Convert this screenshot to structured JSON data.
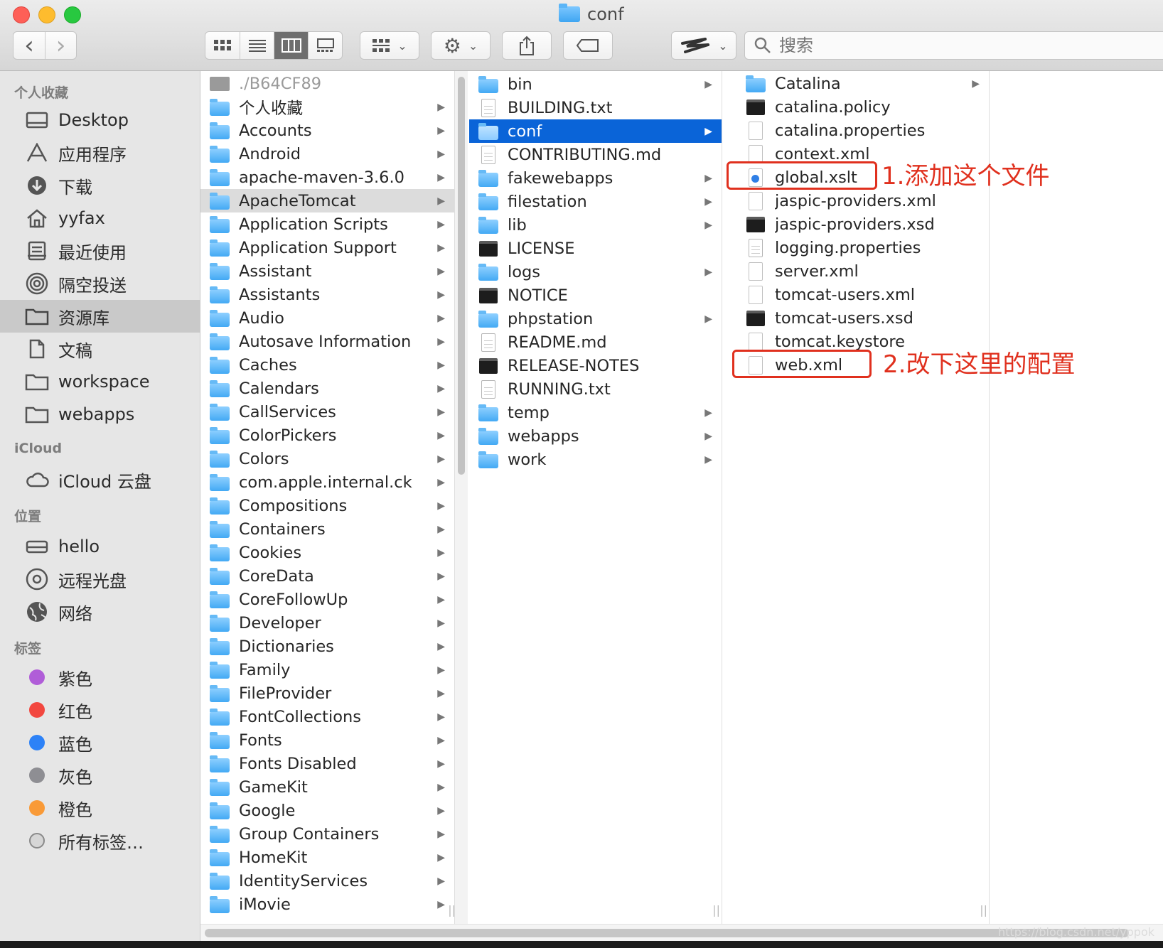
{
  "window": {
    "title": "conf"
  },
  "toolbar": {
    "back_glyph": "‹",
    "forward_glyph": "›",
    "search_placeholder": "搜索"
  },
  "sidebar": {
    "favorites_header": "个人收藏",
    "favorites": [
      {
        "label": "Desktop",
        "icon": "desktop-icon"
      },
      {
        "label": "应用程序",
        "icon": "applications-icon"
      },
      {
        "label": "下载",
        "icon": "download-icon"
      },
      {
        "label": "yyfax",
        "icon": "home-icon"
      },
      {
        "label": "最近使用",
        "icon": "recents-icon"
      },
      {
        "label": "隔空投送",
        "icon": "airdrop-icon"
      },
      {
        "label": "资源库",
        "icon": "folder-icon",
        "selected": true
      },
      {
        "label": "文稿",
        "icon": "documents-icon"
      },
      {
        "label": "workspace",
        "icon": "folder-icon"
      },
      {
        "label": "webapps",
        "icon": "folder-icon"
      }
    ],
    "icloud_header": "iCloud",
    "icloud": [
      {
        "label": "iCloud 云盘",
        "icon": "cloud-icon"
      }
    ],
    "locations_header": "位置",
    "locations": [
      {
        "label": "hello",
        "icon": "drive-icon"
      },
      {
        "label": "远程光盘",
        "icon": "disc-icon"
      },
      {
        "label": "网络",
        "icon": "network-icon"
      }
    ],
    "tags_header": "标签",
    "tags": [
      {
        "label": "紫色",
        "color": "#b05dd8"
      },
      {
        "label": "红色",
        "color": "#f2473f"
      },
      {
        "label": "蓝色",
        "color": "#2d82f7"
      },
      {
        "label": "灰色",
        "color": "#8e8e93"
      },
      {
        "label": "橙色",
        "color": "#f99a37"
      },
      {
        "label": "所有标签…",
        "color": ""
      }
    ]
  },
  "columns": [
    {
      "items": [
        {
          "label": "./B64CF89",
          "type": "drive",
          "dim": true
        },
        {
          "label": "个人收藏",
          "type": "folder",
          "chevron": true
        },
        {
          "label": "Accounts",
          "type": "folder",
          "chevron": true
        },
        {
          "label": "Android",
          "type": "folder",
          "chevron": true
        },
        {
          "label": "apache-maven-3.6.0",
          "type": "folder",
          "chevron": true
        },
        {
          "label": "ApacheTomcat",
          "type": "folder",
          "chevron": true,
          "selected": "gray"
        },
        {
          "label": "Application Scripts",
          "type": "folder",
          "chevron": true
        },
        {
          "label": "Application Support",
          "type": "folder",
          "chevron": true
        },
        {
          "label": "Assistant",
          "type": "folder",
          "chevron": true
        },
        {
          "label": "Assistants",
          "type": "folder",
          "chevron": true
        },
        {
          "label": "Audio",
          "type": "folder",
          "chevron": true
        },
        {
          "label": "Autosave Information",
          "type": "folder",
          "chevron": true
        },
        {
          "label": "Caches",
          "type": "folder",
          "chevron": true
        },
        {
          "label": "Calendars",
          "type": "folder",
          "chevron": true
        },
        {
          "label": "CallServices",
          "type": "folder",
          "chevron": true
        },
        {
          "label": "ColorPickers",
          "type": "folder",
          "chevron": true
        },
        {
          "label": "Colors",
          "type": "folder",
          "chevron": true
        },
        {
          "label": "com.apple.internal.ck",
          "type": "folder",
          "chevron": true
        },
        {
          "label": "Compositions",
          "type": "folder",
          "chevron": true
        },
        {
          "label": "Containers",
          "type": "folder",
          "chevron": true
        },
        {
          "label": "Cookies",
          "type": "folder",
          "chevron": true
        },
        {
          "label": "CoreData",
          "type": "folder",
          "chevron": true
        },
        {
          "label": "CoreFollowUp",
          "type": "folder",
          "chevron": true
        },
        {
          "label": "Developer",
          "type": "folder",
          "chevron": true
        },
        {
          "label": "Dictionaries",
          "type": "folder",
          "chevron": true
        },
        {
          "label": "Family",
          "type": "folder",
          "chevron": true
        },
        {
          "label": "FileProvider",
          "type": "folder",
          "chevron": true
        },
        {
          "label": "FontCollections",
          "type": "folder",
          "chevron": true
        },
        {
          "label": "Fonts",
          "type": "folder",
          "chevron": true
        },
        {
          "label": "Fonts Disabled",
          "type": "folder",
          "chevron": true
        },
        {
          "label": "GameKit",
          "type": "folder",
          "chevron": true
        },
        {
          "label": "Google",
          "type": "folder",
          "chevron": true
        },
        {
          "label": "Group Containers",
          "type": "folder",
          "chevron": true
        },
        {
          "label": "HomeKit",
          "type": "folder",
          "chevron": true
        },
        {
          "label": "IdentityServices",
          "type": "folder",
          "chevron": true
        },
        {
          "label": "iMovie",
          "type": "folder",
          "chevron": true
        }
      ]
    },
    {
      "items": [
        {
          "label": "bin",
          "type": "folder",
          "chevron": true
        },
        {
          "label": "BUILDING.txt",
          "type": "doc"
        },
        {
          "label": "conf",
          "type": "folder",
          "chevron": true,
          "selected": "blue"
        },
        {
          "label": "CONTRIBUTING.md",
          "type": "doc"
        },
        {
          "label": "fakewebapps",
          "type": "folder",
          "chevron": true
        },
        {
          "label": "filestation",
          "type": "folder",
          "chevron": true
        },
        {
          "label": "lib",
          "type": "folder",
          "chevron": true
        },
        {
          "label": "LICENSE",
          "type": "exec"
        },
        {
          "label": "logs",
          "type": "folder",
          "chevron": true
        },
        {
          "label": "NOTICE",
          "type": "exec"
        },
        {
          "label": "phpstation",
          "type": "folder",
          "chevron": true
        },
        {
          "label": "README.md",
          "type": "doc"
        },
        {
          "label": "RELEASE-NOTES",
          "type": "exec"
        },
        {
          "label": "RUNNING.txt",
          "type": "doc"
        },
        {
          "label": "temp",
          "type": "folder",
          "chevron": true
        },
        {
          "label": "webapps",
          "type": "folder",
          "chevron": true
        },
        {
          "label": "work",
          "type": "folder",
          "chevron": true
        }
      ]
    },
    {
      "items": [
        {
          "label": "Catalina",
          "type": "folder",
          "chevron": true
        },
        {
          "label": "catalina.policy",
          "type": "exec"
        },
        {
          "label": "catalina.properties",
          "type": "blank"
        },
        {
          "label": "context.xml",
          "type": "blank"
        },
        {
          "label": "global.xslt",
          "type": "xslt"
        },
        {
          "label": "jaspic-providers.xml",
          "type": "blank"
        },
        {
          "label": "jaspic-providers.xsd",
          "type": "exec"
        },
        {
          "label": "logging.properties",
          "type": "doc"
        },
        {
          "label": "server.xml",
          "type": "blank"
        },
        {
          "label": "tomcat-users.xml",
          "type": "blank"
        },
        {
          "label": "tomcat-users.xsd",
          "type": "exec"
        },
        {
          "label": "tomcat.keystore",
          "type": "blank"
        },
        {
          "label": "web.xml",
          "type": "blank"
        }
      ]
    }
  ],
  "annotations": {
    "note1": "1.添加这个文件",
    "note2": "2.改下这里的配置",
    "color": "#e0301e"
  },
  "watermark": "https://blog.csdn.net/yppok"
}
